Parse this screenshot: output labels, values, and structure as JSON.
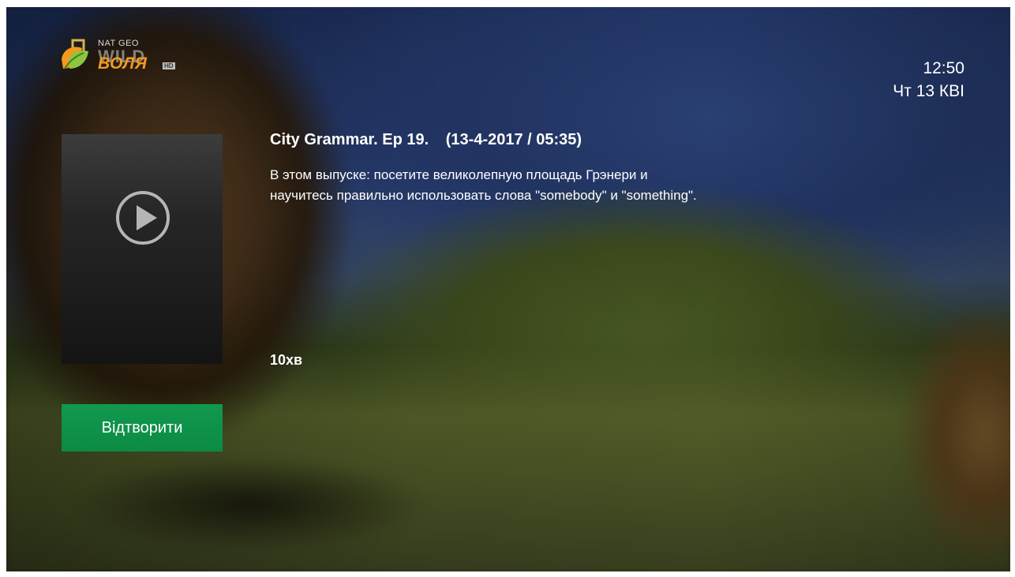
{
  "channel": {
    "logo_line1": "NAT GEO",
    "logo_line2": "WILD",
    "logo_brand": "ВОЛЯ",
    "logo_hd": "HD",
    "logo_icon": "leaf-logo-icon"
  },
  "clock": {
    "time": "12:50",
    "date": "Чт 13 КВІ"
  },
  "program": {
    "title": "City Grammar. Ep 19.",
    "airdate": "(13-4-2017 / 05:35)",
    "description": "В этом выпуске: посетите великолепную площадь Грэнери и научитесь правильно использовать слова \"somebody\" и \"something\".",
    "duration": "10хв"
  },
  "actions": {
    "play_label": "Відтворити",
    "play_icon": "play-circle-icon"
  },
  "colors": {
    "accent_green": "#0f934b",
    "brand_orange": "#f39a1e"
  }
}
